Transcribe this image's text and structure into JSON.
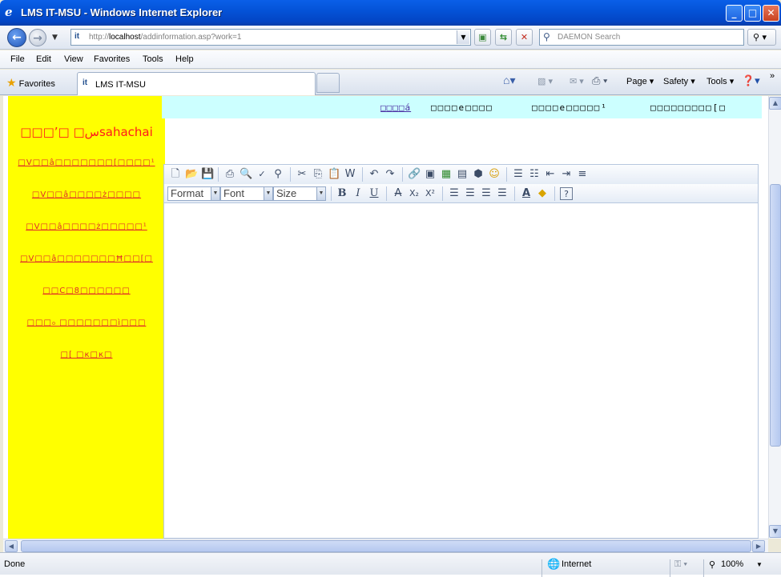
{
  "window": {
    "title": "LMS IT-MSU - Windows Internet Explorer",
    "ie_icon": "e"
  },
  "address": {
    "prefix": "http://",
    "host": "localhost",
    "path": "/addinformation.asp?work=1"
  },
  "search": {
    "placeholder": "DAEMON Search"
  },
  "menu": [
    "File",
    "Edit",
    "View",
    "Favorites",
    "Tools",
    "Help"
  ],
  "favorites": {
    "label": "Favorites"
  },
  "tab": {
    "label": "LMS IT-MSU"
  },
  "commands": {
    "page": "Page ▾",
    "safety": "Safety ▾",
    "tools": "Tools ▾"
  },
  "status": {
    "text": "Done",
    "zone": "Internet",
    "zoom": "100%"
  },
  "page": {
    "greeting": "□□□’□ □سsahachai",
    "sidebar_links": [
      "□V□□â□□□□□□□[□□□□¹",
      "□V□□â□□□□ż□□□□",
      "□V□□â□□□□ż□□□□□¹",
      "□V□□â□□□□□□□Ħ□□[□",
      "□□C□8□□□□□□",
      "□□□₀ □□□□□□□ì□□□",
      "□[ □к□к□"
    ],
    "top_links": [
      "□□□□á",
      "□□□□e□□□□",
      "□□□□e□□□□□¹",
      "□□□□□□□□□[□"
    ]
  },
  "editor": {
    "format_label": "Format",
    "font_label": "Font",
    "size_label": "Size"
  },
  "colors": {
    "sidebar_bg": "#ffff00",
    "topstrip_bg": "#ccffff",
    "sidebar_link": "#e02a2a"
  }
}
